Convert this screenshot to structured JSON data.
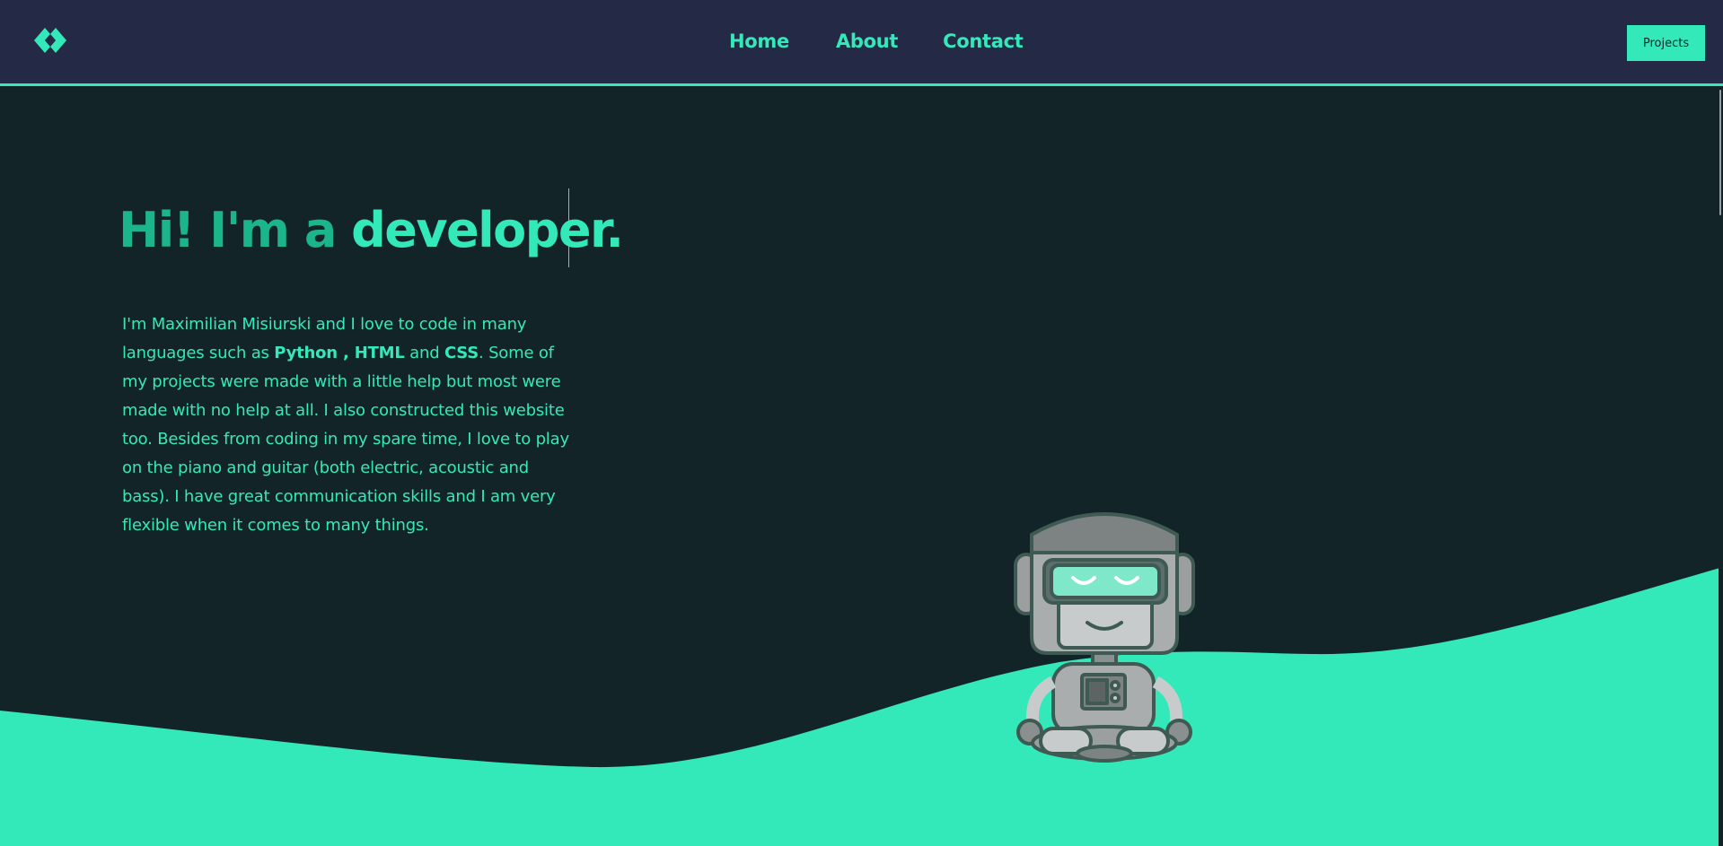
{
  "nav": {
    "logo_icon": "code-brackets-icon",
    "items": [
      {
        "label": "Home"
      },
      {
        "label": "About"
      },
      {
        "label": "Contact"
      }
    ],
    "projects_label": "Projects"
  },
  "hero": {
    "heading_prefix": "Hi! I'm a ",
    "heading_word": "developer.",
    "bio": {
      "part1": "I'm Maximilian Misiurski and I love to code in many languages such as ",
      "lang1": "Python",
      "sep1": " , ",
      "lang2": "HTML",
      "sep2": " and ",
      "lang3": "CSS",
      "part2": ". Some of my projects were made with a little help but most were made with no help at all. I also constructed this website too. Besides from coding in my spare time, I love to play on the piano and guitar (both electric, acoustic and bass). I have great communication skills and I am very flexible when it comes to many things."
    },
    "illustration_icon": "meditating-robot-icon"
  },
  "colors": {
    "header_bg": "#242945",
    "page_bg": "#132429",
    "accent": "#33e9b9",
    "accent_dark": "#1cb58a"
  }
}
